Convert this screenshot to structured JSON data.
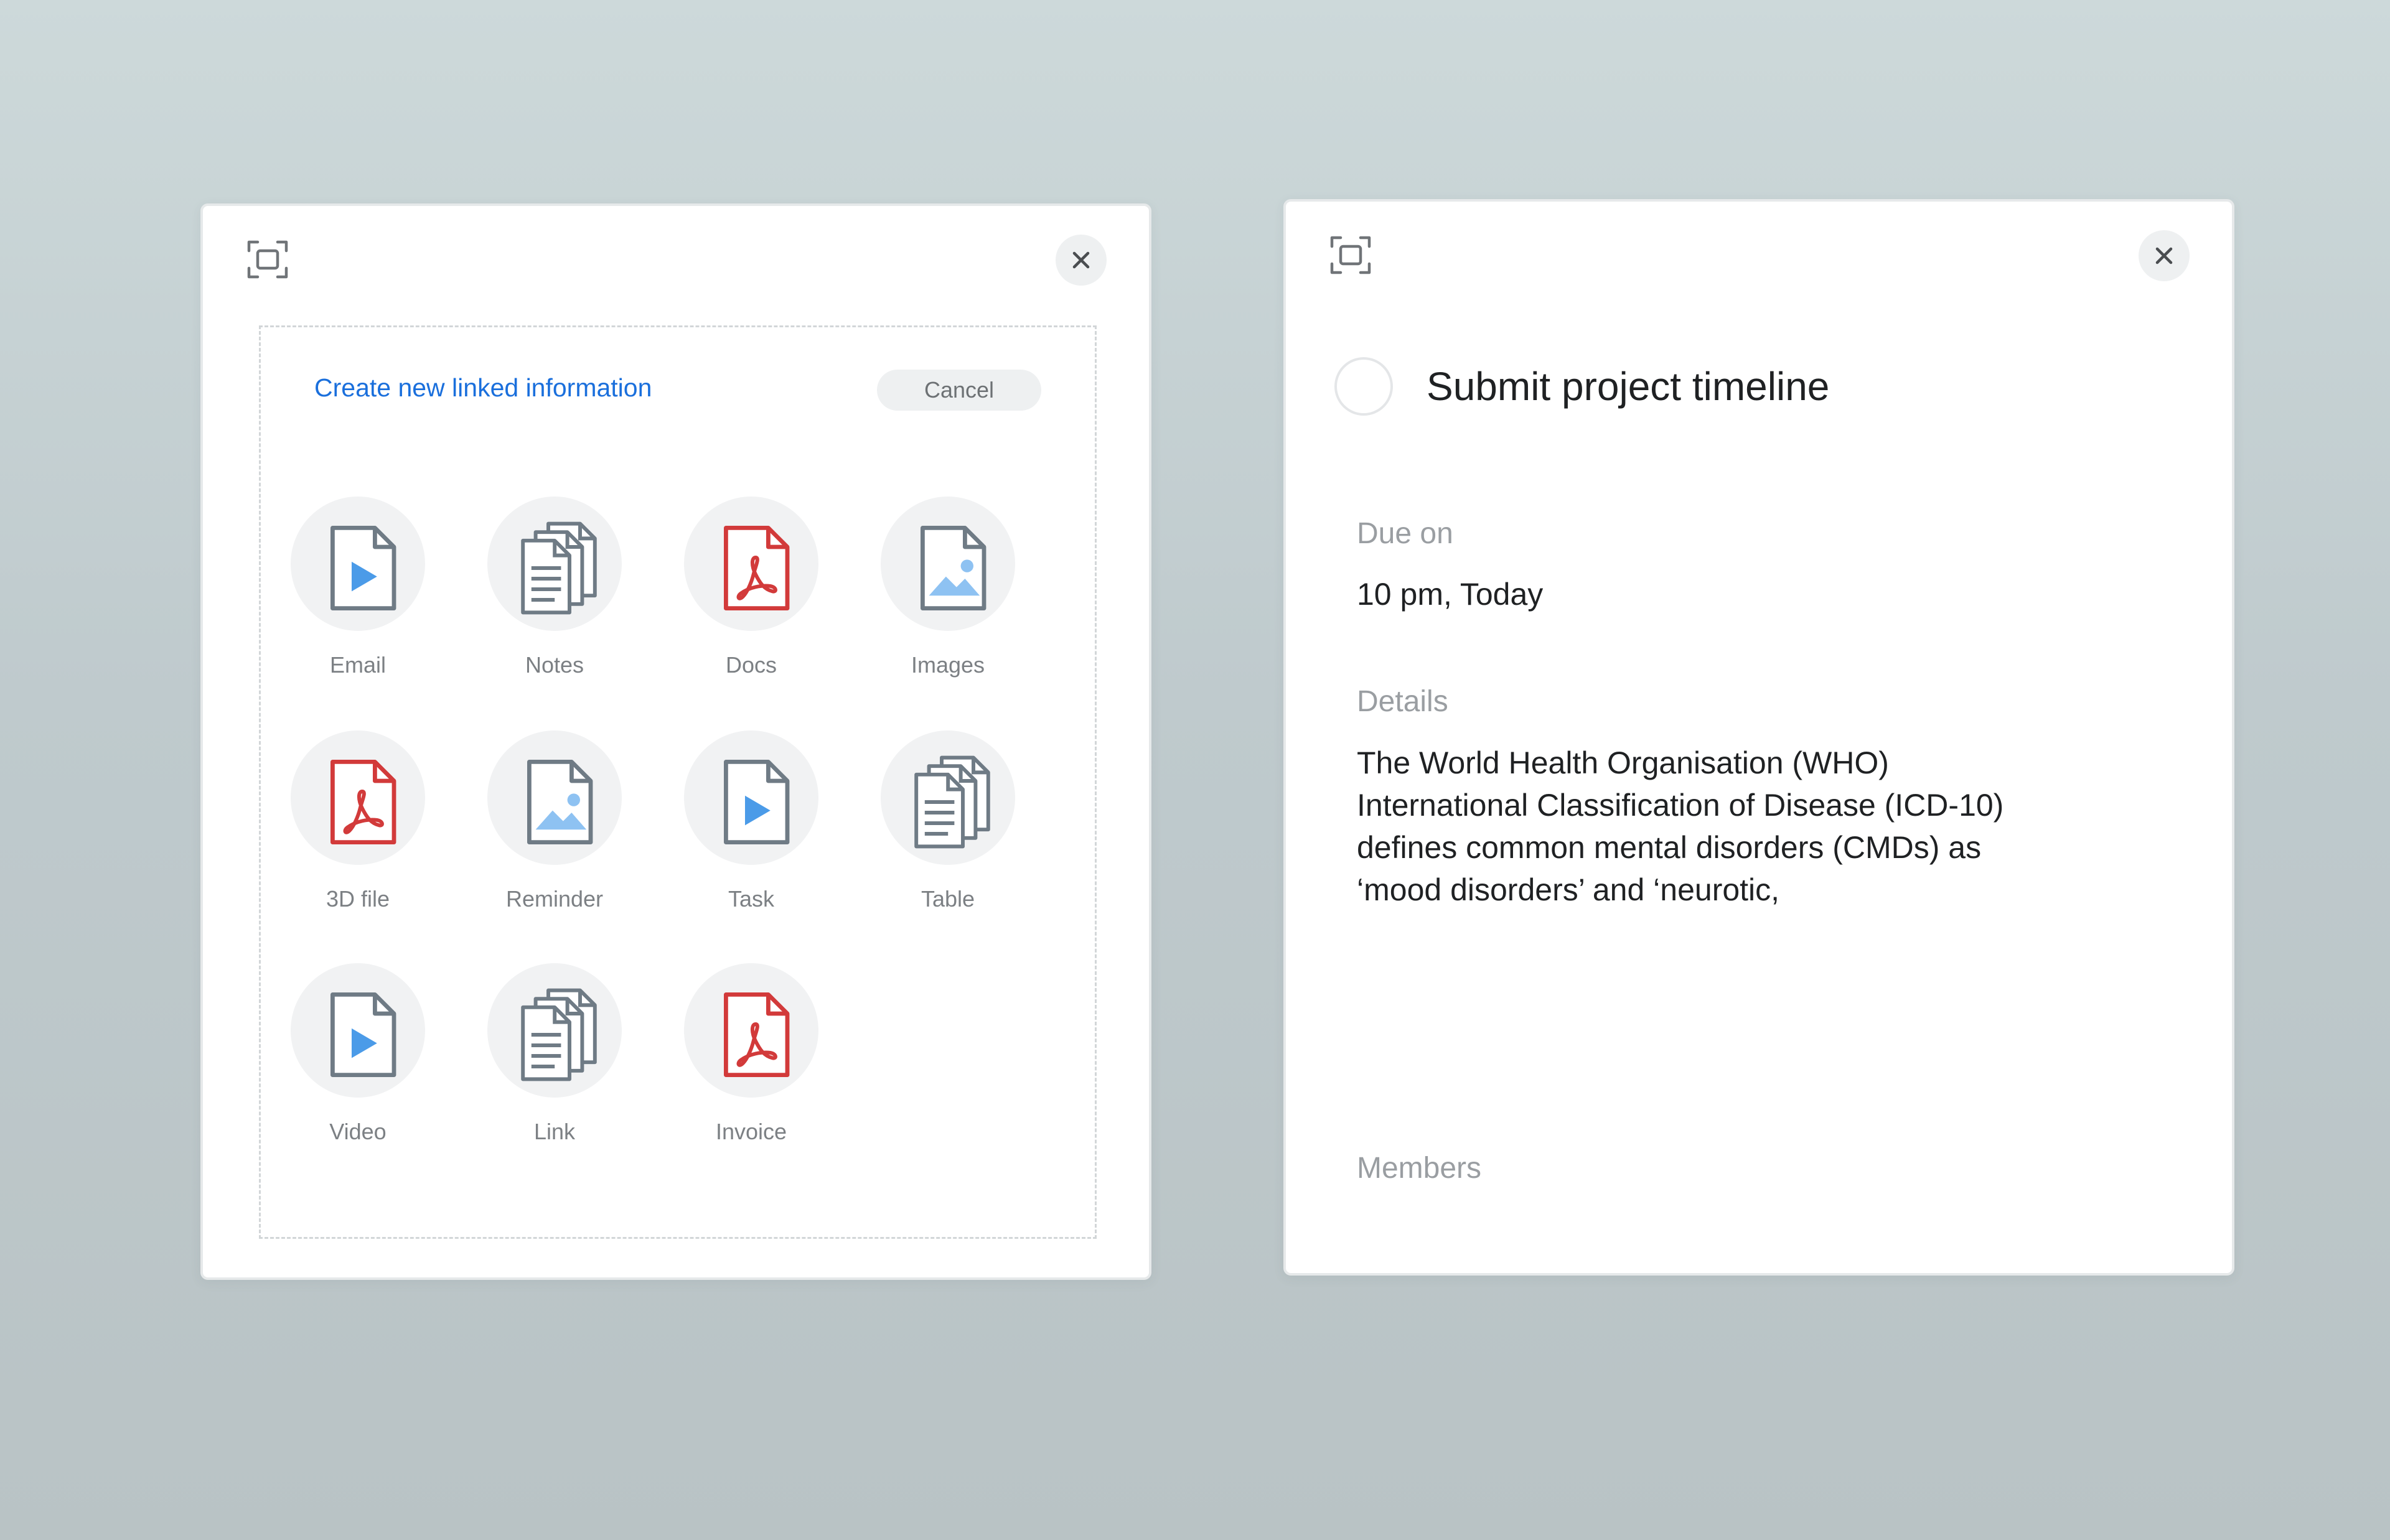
{
  "colors": {
    "accent": "#1a6fdc",
    "video_blue": "#4b9be8",
    "pdf_red": "#d23a3a",
    "doc_grey": "#6f7b85"
  },
  "left_panel": {
    "expand_icon": "expand-icon",
    "close_icon": "close-icon",
    "create_link_label": "Create new linked information",
    "cancel_label": "Cancel",
    "items": [
      {
        "label": "Email",
        "icon": "video-file-icon"
      },
      {
        "label": "Notes",
        "icon": "documents-icon"
      },
      {
        "label": "Docs",
        "icon": "pdf-file-icon"
      },
      {
        "label": "Images",
        "icon": "image-file-icon"
      },
      {
        "label": "3D file",
        "icon": "pdf-file-icon"
      },
      {
        "label": "Reminder",
        "icon": "image-file-icon"
      },
      {
        "label": "Task",
        "icon": "video-file-icon"
      },
      {
        "label": "Table",
        "icon": "documents-icon"
      },
      {
        "label": "Video",
        "icon": "video-file-icon"
      },
      {
        "label": "Link",
        "icon": "documents-icon"
      },
      {
        "label": "Invoice",
        "icon": "pdf-file-icon"
      }
    ]
  },
  "right_panel": {
    "expand_icon": "expand-icon",
    "close_icon": "close-icon",
    "task_title": "Submit project timeline",
    "due_label": "Due on",
    "due_value": "10 pm, Today",
    "details_label": "Details",
    "details_lines": [
      "The World Health Organisation (WHO)",
      "International Classification of Disease (ICD-10)",
      "defines common mental disorders (CMDs) as",
      "‘mood disorders’ and ‘neurotic,"
    ],
    "members_label": "Members"
  }
}
